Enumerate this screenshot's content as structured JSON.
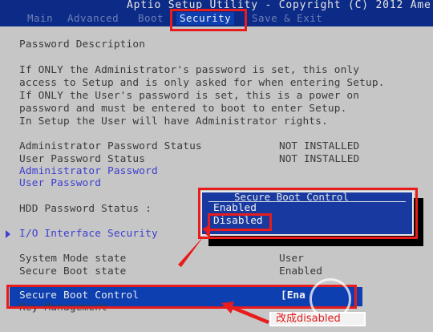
{
  "header": {
    "title": "Aptio Setup Utility - Copyright (C) 2012 Ame",
    "tabs": [
      {
        "label": "Main"
      },
      {
        "label": "Advanced"
      },
      {
        "label": "Boot"
      },
      {
        "label": "Security"
      },
      {
        "label": "Save & Exit"
      }
    ]
  },
  "content": {
    "section_title": "Password Description",
    "description_lines": [
      "If ONLY the Administrator's password is set, this only",
      "access to Setup and is only asked for when entering Setup.",
      "If ONLY the User's password is set, this is a power on",
      "password and must be entered to boot to enter Setup.",
      "In Setup the User will have Administrator rights."
    ],
    "admin_status_label": "Administrator Password Status",
    "admin_status_value": "NOT INSTALLED",
    "user_status_label": "User Password Status",
    "user_status_value": "NOT INSTALLED",
    "admin_password_label": "Administrator Password",
    "user_password_label": "User Password",
    "hdd_status_label": "HDD Password Status  :",
    "io_security_label": "I/O Interface Security",
    "system_mode_label": "System Mode state",
    "system_mode_value": "User",
    "secure_boot_state_label": "Secure Boot state",
    "secure_boot_state_value": "Enabled",
    "secure_boot_control_label": "Secure Boot Control",
    "secure_boot_control_value": "[Ena",
    "key_management_label": "Key Management"
  },
  "popup": {
    "title": "Secure Boot Control",
    "options": [
      "Enabled",
      "Disabled"
    ],
    "selected": "Disabled"
  },
  "annotation": {
    "text": "改成disabled"
  },
  "colors": {
    "bios_blue": "#0f2f8a",
    "panel_gray": "#c6c6c6",
    "link_blue": "#3d3fd0",
    "highlight_red": "#e81c1c"
  }
}
